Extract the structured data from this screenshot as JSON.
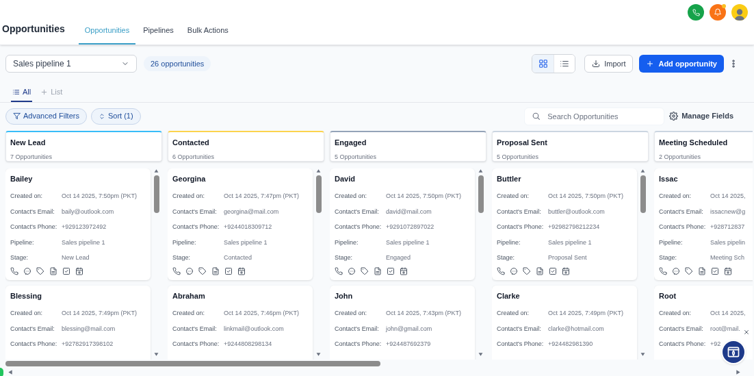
{
  "header": {
    "title": "Opportunities",
    "tabs": [
      {
        "label": "Opportunities",
        "selected": true
      },
      {
        "label": "Pipelines",
        "selected": false
      },
      {
        "label": "Bulk Actions",
        "selected": false
      }
    ],
    "notification_dot": true
  },
  "toolbar": {
    "pipeline": "Sales pipeline 1",
    "count": "26 opportunities",
    "views": [
      {
        "kind": "grid",
        "selected": true
      },
      {
        "kind": "list",
        "selected": false
      }
    ],
    "import": "Import",
    "add": "Add opportunity"
  },
  "view_tabs": [
    {
      "label": "All",
      "kind": "all",
      "selected": true
    },
    {
      "label": "List",
      "kind": "add",
      "selected": false
    }
  ],
  "filters": {
    "advanced": "Advanced Filters",
    "sort": "Sort (1)",
    "search_placeholder": "Search Opportunities",
    "manage": "Manage Fields"
  },
  "columns": [
    {
      "title": "New Lead",
      "count": "7 Opportunities",
      "color": "#38bdf8",
      "cards": [
        {
          "name": "Bailey",
          "show_actions": true,
          "fields": [
            {
              "label": "Created on:",
              "value": "Oct 14 2025, 7:50pm (PKT)"
            },
            {
              "label": "Contact's Email:",
              "value": "baily@outlook.com"
            },
            {
              "label": "Contact's Phone:",
              "value": "+929123972492"
            },
            {
              "label": "Pipeline:",
              "value": "Sales pipeline 1"
            },
            {
              "label": "Stage:",
              "value": "New Lead"
            }
          ]
        },
        {
          "name": "Blessing",
          "show_actions": false,
          "fields": [
            {
              "label": "Created on:",
              "value": "Oct 14 2025, 7:49pm (PKT)"
            },
            {
              "label": "Contact's Email:",
              "value": "blessing@mail.com"
            },
            {
              "label": "Contact's Phone:",
              "value": "+92782917398102"
            }
          ]
        }
      ]
    },
    {
      "title": "Contacted",
      "count": "6 Opportunities",
      "color": "#fcd34d",
      "cards": [
        {
          "name": "Georgina",
          "show_actions": true,
          "fields": [
            {
              "label": "Created on:",
              "value": "Oct 14 2025, 7:47pm (PKT)"
            },
            {
              "label": "Contact's Email:",
              "value": "georgina@mail.com"
            },
            {
              "label": "Contact's Phone:",
              "value": "+9244018309712"
            },
            {
              "label": "Pipeline:",
              "value": "Sales pipeline 1"
            },
            {
              "label": "Stage:",
              "value": "Contacted"
            }
          ]
        },
        {
          "name": "Abraham",
          "show_actions": false,
          "fields": [
            {
              "label": "Created on:",
              "value": "Oct 14 2025, 7:46pm (PKT)"
            },
            {
              "label": "Contact's Email:",
              "value": "linkmail@outlook.com"
            },
            {
              "label": "Contact's Phone:",
              "value": "+9244808298134"
            }
          ]
        }
      ]
    },
    {
      "title": "Engaged",
      "count": "5 Opportunities",
      "color": "#94a3b8",
      "cards": [
        {
          "name": "David",
          "show_actions": true,
          "fields": [
            {
              "label": "Created on:",
              "value": "Oct 14 2025, 7:50pm (PKT)"
            },
            {
              "label": "Contact's Email:",
              "value": "david@mail.com"
            },
            {
              "label": "Contact's Phone:",
              "value": "+9291072897022"
            },
            {
              "label": "Pipeline:",
              "value": "Sales pipeline 1"
            },
            {
              "label": "Stage:",
              "value": "Engaged"
            }
          ]
        },
        {
          "name": "John",
          "show_actions": false,
          "fields": [
            {
              "label": "Created on:",
              "value": "Oct 14 2025, 7:43pm (PKT)"
            },
            {
              "label": "Contact's Email:",
              "value": "john@gmail.com"
            },
            {
              "label": "Contact's Phone:",
              "value": "+924487692379"
            }
          ]
        }
      ]
    },
    {
      "title": "Proposal Sent",
      "count": "5 Opportunities",
      "color": "#cbd5e1",
      "cards": [
        {
          "name": "Buttler",
          "show_actions": true,
          "fields": [
            {
              "label": "Created on:",
              "value": "Oct 14 2025, 7:50pm (PKT)"
            },
            {
              "label": "Contact's Email:",
              "value": "buttler@outlook.com"
            },
            {
              "label": "Contact's Phone:",
              "value": "+92982798212234"
            },
            {
              "label": "Pipeline:",
              "value": "Sales pipeline 1"
            },
            {
              "label": "Stage:",
              "value": "Proposal Sent"
            }
          ]
        },
        {
          "name": "Clarke",
          "show_actions": false,
          "fields": [
            {
              "label": "Created on:",
              "value": "Oct 14 2025, 7:49pm (PKT)"
            },
            {
              "label": "Contact's Email:",
              "value": "clarke@hotmail.com"
            },
            {
              "label": "Contact's Phone:",
              "value": "+924482981390"
            }
          ]
        }
      ]
    },
    {
      "title": "Meeting Scheduled",
      "count": "2 Opportunities",
      "color": "#cbd5e1",
      "cards": [
        {
          "name": "Issac",
          "show_actions": true,
          "fields": [
            {
              "label": "Created on:",
              "value": "Oct 14 2025,"
            },
            {
              "label": "Contact's Email:",
              "value": "issacnew@g"
            },
            {
              "label": "Contact's Phone:",
              "value": "+928712837"
            },
            {
              "label": "Pipeline:",
              "value": "Sales pipelin"
            },
            {
              "label": "Stage:",
              "value": "Meeting Sch"
            }
          ]
        },
        {
          "name": "Root",
          "show_actions": false,
          "fields": [
            {
              "label": "Created on:",
              "value": "Oct 14 2025,"
            },
            {
              "label": "Contact's Email:",
              "value": "root@mail."
            },
            {
              "label": "Contact's Phone:",
              "value": "+92"
            }
          ]
        }
      ]
    }
  ]
}
